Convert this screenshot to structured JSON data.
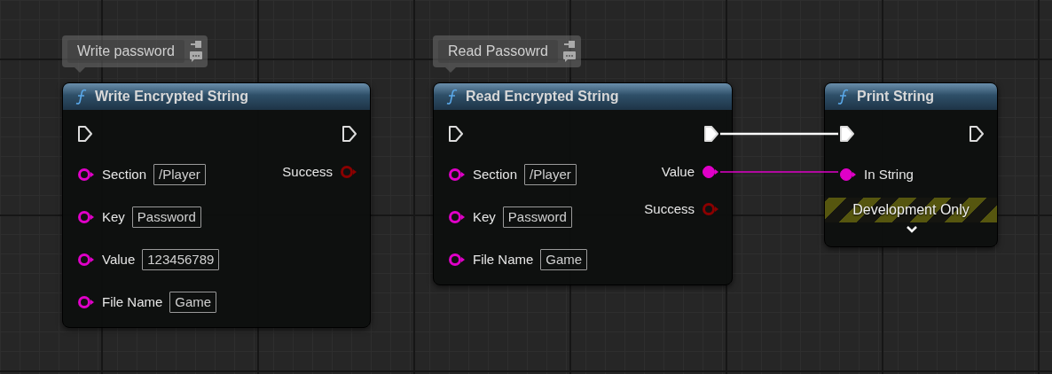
{
  "nodes": [
    {
      "comment": "Write password",
      "title": "Write Encrypted String",
      "exec_in": {
        "connected": false
      },
      "exec_out": {
        "connected": false
      },
      "inputs": [
        {
          "label": "Section",
          "value": "/Player",
          "color": "#e000c8",
          "connected": false
        },
        {
          "label": "Key",
          "value": "Password",
          "color": "#e000c8",
          "connected": false
        },
        {
          "label": "Value",
          "value": "123456789",
          "color": "#e000c8",
          "connected": false
        },
        {
          "label": "File Name",
          "value": "Game",
          "color": "#e000c8",
          "connected": false
        }
      ],
      "outputs": [
        {
          "label": "Success",
          "color": "#8a0000",
          "connected": false
        }
      ]
    },
    {
      "comment": "Read Passowrd",
      "title": "Read Encrypted String",
      "exec_in": {
        "connected": false
      },
      "exec_out": {
        "connected": true
      },
      "inputs": [
        {
          "label": "Section",
          "value": "/Player",
          "color": "#e000c8",
          "connected": false
        },
        {
          "label": "Key",
          "value": "Password",
          "color": "#e000c8",
          "connected": false
        },
        {
          "label": "File Name",
          "value": "Game",
          "color": "#e000c8",
          "connected": false
        }
      ],
      "outputs": [
        {
          "label": "Value",
          "color": "#e000c8",
          "connected": true
        },
        {
          "label": "Success",
          "color": "#8a0000",
          "connected": false
        }
      ]
    },
    {
      "title": "Print String",
      "exec_in": {
        "connected": true
      },
      "exec_out": {
        "connected": false
      },
      "inputs": [
        {
          "label": "In String",
          "color": "#e000c8",
          "connected": true
        }
      ],
      "development_only": true,
      "development_label": "Development Only"
    }
  ]
}
